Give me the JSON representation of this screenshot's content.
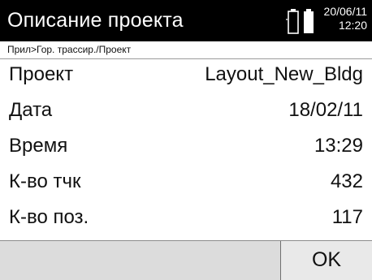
{
  "header": {
    "title": "Описание проекта",
    "date": "20/06/11",
    "time": "12:20",
    "icons": [
      "laser-sun-icon",
      "battery-icon",
      "battery-icon"
    ]
  },
  "breadcrumb": "Прил>Гор. трассир./Проект",
  "details": [
    {
      "label": "Проект",
      "value": "Layout_New_Bldg"
    },
    {
      "label": "Дата",
      "value": "18/02/11"
    },
    {
      "label": "Время",
      "value": "13:29"
    },
    {
      "label": "К-во тчк",
      "value": "432"
    },
    {
      "label": "К-во поз.",
      "value": "117"
    }
  ],
  "footer": {
    "ok_label": "OK"
  }
}
